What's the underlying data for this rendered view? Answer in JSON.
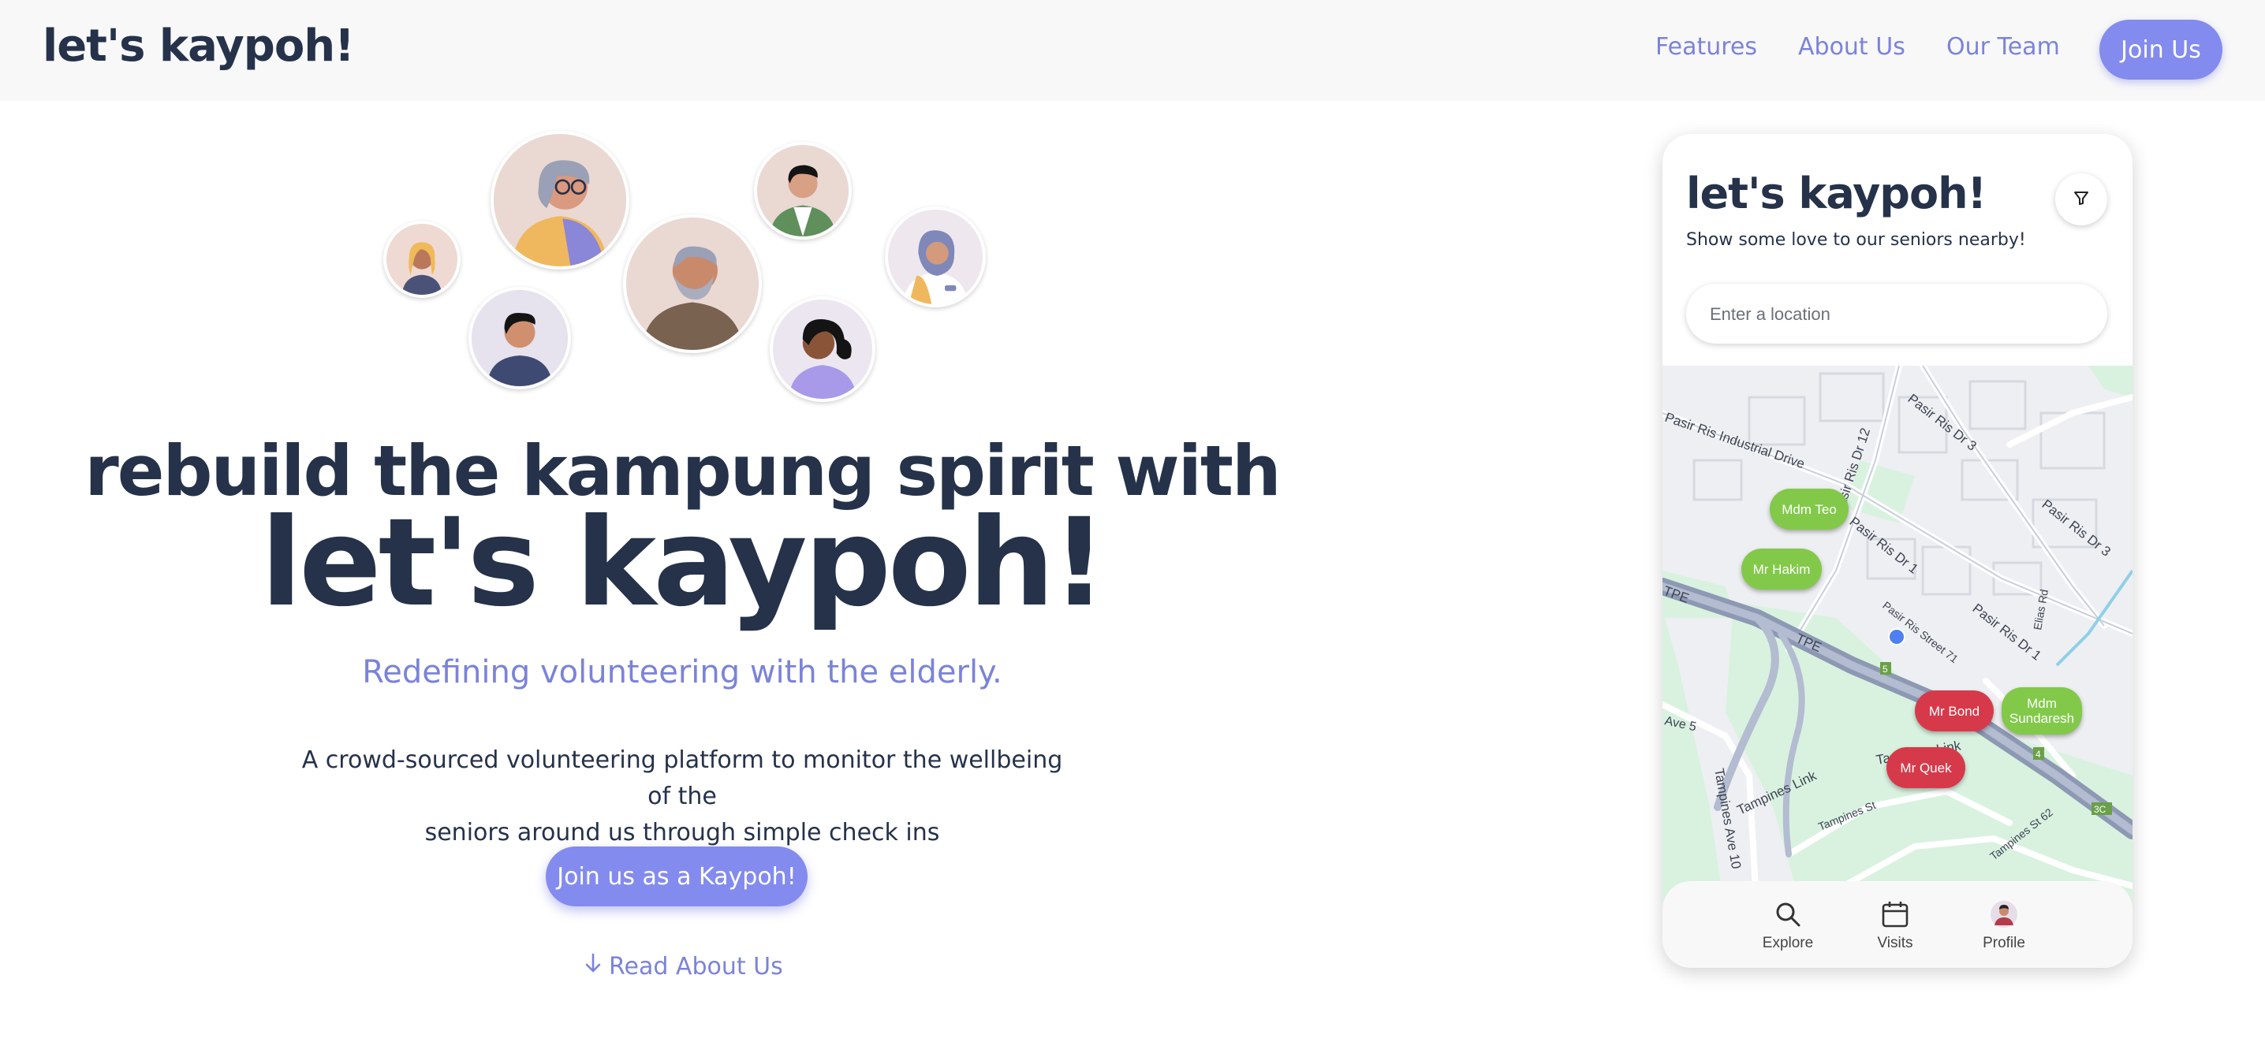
{
  "nav": {
    "brand": "let's kaypoh!",
    "links": [
      "Features",
      "About Us",
      "Our Team"
    ],
    "join_label": "Join Us"
  },
  "hero": {
    "tagline": "rebuild the kampung spirit with",
    "title": "let's kaypoh!",
    "subtitle": "Redefining volunteering with the elderly.",
    "description_line1": "A crowd-sourced volunteering platform to monitor the wellbeing of the",
    "description_line2": "seniors around us through simple check ins",
    "cta_label": "Join us as a Kaypoh!",
    "read_more_label": "Read About Us"
  },
  "phone": {
    "brand": "let's kaypoh!",
    "subtitle": "Show some love to our seniors nearby!",
    "search_placeholder": "Enter a location",
    "map_labels": {
      "industrial": "Pasir Ris Industrial Drive",
      "dr12": "Pasir Ris Dr 12",
      "dr3a": "Pasir Ris Dr 3",
      "dr3b": "Pasir Ris Dr 3",
      "dr1a": "Pasir Ris Dr 1",
      "dr1b": "Pasir Ris Dr 1",
      "street71": "Pasir Ris Street 71",
      "elias": "Elias Rd",
      "tpe1": "TPE",
      "tpe2": "TPE",
      "ave5": "Ave 5",
      "tampines_link1": "Tampines Link",
      "tampines_link2": "Tampines Link",
      "tampines_ave10": "Tampines Ave 10",
      "tampines_st": "Tampines St",
      "tampines_st62": "Tampines St 62",
      "exit5": "5",
      "exit4": "4",
      "exit3c": "3C"
    },
    "markers": [
      {
        "name": "Mdm Teo",
        "status": "green"
      },
      {
        "name": "Mr Hakim",
        "status": "green"
      },
      {
        "name": "Mr Bond",
        "status": "red"
      },
      {
        "name": "Mdm Sundaresh",
        "status": "green"
      },
      {
        "name": "Mr Quek",
        "status": "red"
      }
    ],
    "bottom_nav": [
      "Explore",
      "Visits",
      "Profile"
    ]
  },
  "colors": {
    "primary": "#838bee",
    "text_dark": "#25324a",
    "accent_text": "#7b83d8",
    "marker_ok": "#82c94a",
    "marker_alert": "#d63a4a",
    "map_green": "#d9f2e0",
    "map_road": "#a7b1c6"
  }
}
